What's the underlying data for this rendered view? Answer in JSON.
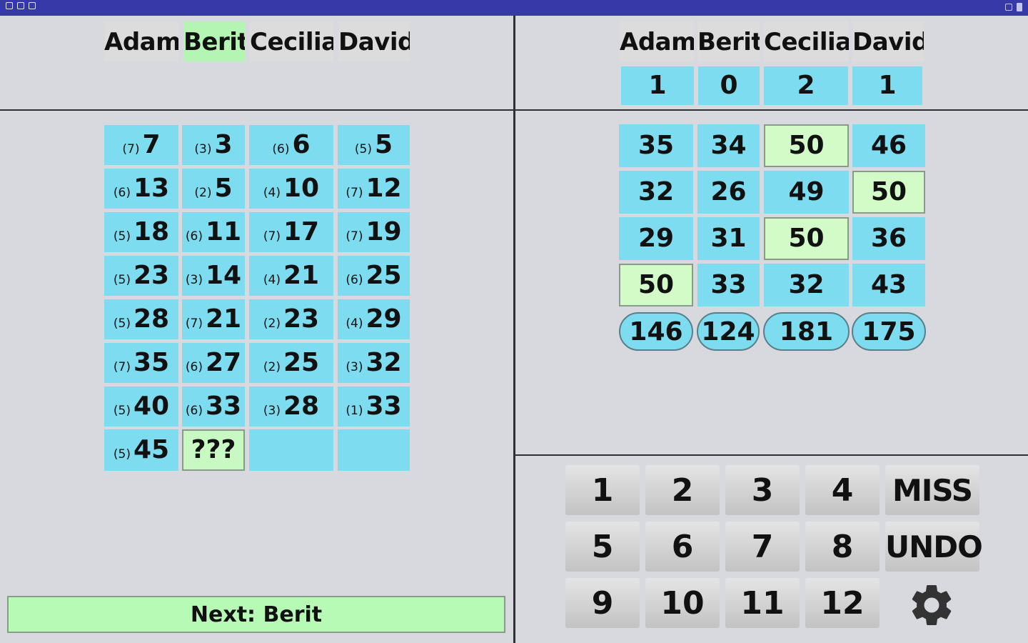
{
  "players": [
    "Adam",
    "Berit",
    "Cecilia",
    "David"
  ],
  "active_player_index": 1,
  "left_grid": {
    "rows": [
      [
        {
          "count": "(7)",
          "value": "7"
        },
        {
          "count": "(3)",
          "value": "3"
        },
        {
          "count": "(6)",
          "value": "6"
        },
        {
          "count": "(5)",
          "value": "5"
        }
      ],
      [
        {
          "count": "(6)",
          "value": "13"
        },
        {
          "count": "(2)",
          "value": "5"
        },
        {
          "count": "(4)",
          "value": "10"
        },
        {
          "count": "(7)",
          "value": "12"
        }
      ],
      [
        {
          "count": "(5)",
          "value": "18"
        },
        {
          "count": "(6)",
          "value": "11"
        },
        {
          "count": "(7)",
          "value": "17"
        },
        {
          "count": "(7)",
          "value": "19"
        }
      ],
      [
        {
          "count": "(5)",
          "value": "23"
        },
        {
          "count": "(3)",
          "value": "14"
        },
        {
          "count": "(4)",
          "value": "21"
        },
        {
          "count": "(6)",
          "value": "25"
        }
      ],
      [
        {
          "count": "(5)",
          "value": "28"
        },
        {
          "count": "(7)",
          "value": "21"
        },
        {
          "count": "(2)",
          "value": "23"
        },
        {
          "count": "(4)",
          "value": "29"
        }
      ],
      [
        {
          "count": "(7)",
          "value": "35"
        },
        {
          "count": "(6)",
          "value": "27"
        },
        {
          "count": "(2)",
          "value": "25"
        },
        {
          "count": "(3)",
          "value": "32"
        }
      ],
      [
        {
          "count": "(5)",
          "value": "40"
        },
        {
          "count": "(6)",
          "value": "33"
        },
        {
          "count": "(3)",
          "value": "28"
        },
        {
          "count": "(1)",
          "value": "33"
        }
      ],
      [
        {
          "count": "(5)",
          "value": "45"
        },
        {
          "count": "",
          "value": "???",
          "pending": true
        },
        {
          "count": "",
          "value": ""
        },
        {
          "count": "",
          "value": ""
        }
      ]
    ]
  },
  "right_panel": {
    "legs_won": [
      "1",
      "0",
      "2",
      "1"
    ],
    "rows": [
      [
        {
          "value": "35"
        },
        {
          "value": "34"
        },
        {
          "value": "50",
          "hit": true
        },
        {
          "value": "46"
        }
      ],
      [
        {
          "value": "32"
        },
        {
          "value": "26"
        },
        {
          "value": "49"
        },
        {
          "value": "50",
          "hit": true
        }
      ],
      [
        {
          "value": "29"
        },
        {
          "value": "31"
        },
        {
          "value": "50",
          "hit": true
        },
        {
          "value": "36"
        }
      ],
      [
        {
          "value": "50",
          "hit": true
        },
        {
          "value": "33"
        },
        {
          "value": "32"
        },
        {
          "value": "43"
        }
      ]
    ],
    "totals": [
      "146",
      "124",
      "181",
      "175"
    ]
  },
  "keypad": {
    "rows": [
      [
        "1",
        "2",
        "3",
        "4",
        "MISS"
      ],
      [
        "5",
        "6",
        "7",
        "8",
        "UNDO"
      ],
      [
        "9",
        "10",
        "11",
        "12"
      ]
    ],
    "settings_icon": "gear-icon"
  },
  "next_label": "Next: Berit",
  "colors": {
    "status_bar": "#3639a7",
    "cell": "#7ddcef",
    "highlight": "#b4f5b4",
    "background": "#d8d9de"
  }
}
